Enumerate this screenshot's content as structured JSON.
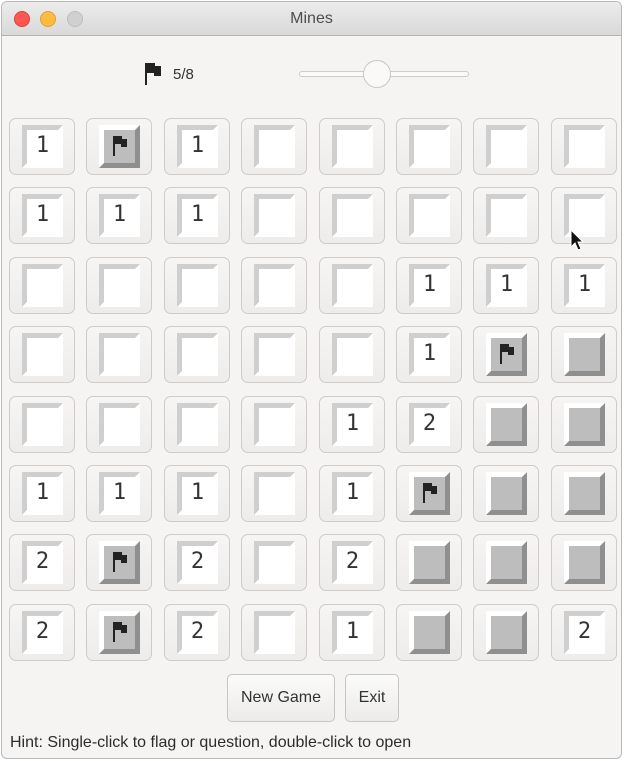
{
  "window": {
    "title": "Mines",
    "controls": [
      "close",
      "minimize",
      "maximize"
    ]
  },
  "toolbar": {
    "flag_icon": "flag-icon",
    "flag_count": "5/8",
    "slider_value": 0.46
  },
  "board": {
    "rows": 8,
    "cols": 8,
    "cells": [
      [
        "1",
        "F",
        "1",
        "",
        "",
        "",
        "",
        ""
      ],
      [
        "1",
        "1",
        "1",
        "",
        "",
        "",
        "",
        ""
      ],
      [
        "",
        "",
        "",
        "",
        "",
        "1",
        "1",
        "1"
      ],
      [
        "",
        "",
        "",
        "",
        "",
        "1",
        "F",
        "H"
      ],
      [
        "",
        "",
        "",
        "",
        "1",
        "2",
        "H",
        "H"
      ],
      [
        "1",
        "1",
        "1",
        "",
        "1",
        "F",
        "H",
        "H"
      ],
      [
        "2",
        "F",
        "2",
        "",
        "2",
        "H",
        "H",
        "H"
      ],
      [
        "2",
        "F",
        "2",
        "",
        "1",
        "H",
        "H",
        "2"
      ]
    ],
    "legend": {
      "F": "flagged",
      "H": "unopened",
      "": "opened-empty"
    }
  },
  "buttons": {
    "new_game": "New Game",
    "exit": "Exit"
  },
  "hint": "Hint: Single-click to flag or question, double-click to open",
  "colors": {
    "close": "#fc5753",
    "minimize": "#fdbc40",
    "maximize": "#d0d0d0",
    "unopened_fill": "#bdbdbd",
    "opened_fill": "#ffffff"
  }
}
